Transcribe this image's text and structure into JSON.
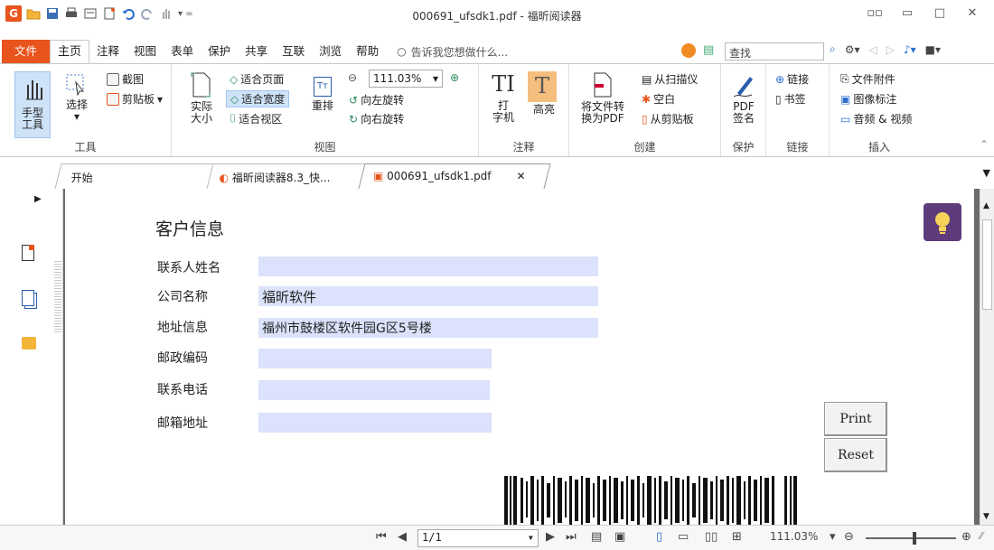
{
  "window": {
    "title": "000691_ufsdk1.pdf - 福昕阅读器"
  },
  "menu": {
    "items": [
      "文件",
      "主页",
      "注释",
      "视图",
      "表单",
      "保护",
      "共享",
      "互联",
      "浏览",
      "帮助"
    ],
    "tell_me": "告诉我您想做什么...",
    "search_placeholder": "查找"
  },
  "ribbon": {
    "tools": {
      "hand": "手型\n工具",
      "select": "选择",
      "screenshot": "截图",
      "clipboard": "剪贴板",
      "label": "工具"
    },
    "view": {
      "actual_size": "实际\n大小",
      "fit_page": "适合页面",
      "fit_width": "适合宽度",
      "fit_view": "适合视区",
      "reflow": "重排",
      "zoom_value": "111.03%",
      "rotate_left": "向左旋转",
      "rotate_right": "向右旋转",
      "label": "视图"
    },
    "comment": {
      "typewriter": "打\n字机",
      "highlight": "高亮",
      "label": "注释"
    },
    "create": {
      "convert": "将文件转\n换为PDF",
      "from_scanner": "从扫描仪",
      "blank": "空白",
      "from_clipboard": "从剪贴板",
      "label": "创建"
    },
    "protect": {
      "pdf_sign": "PDF\n签名",
      "label": "保护"
    },
    "links": {
      "link": "链接",
      "bookmark": "书签",
      "label": "链接"
    },
    "insert": {
      "file_attachment": "文件附件",
      "image_annotation": "图像标注",
      "audio_video": "音频 & 视频",
      "label": "插入"
    }
  },
  "tabs": [
    {
      "label": "开始"
    },
    {
      "label": "福昕阅读器8.3_快..."
    },
    {
      "label": "000691_ufsdk1.pdf"
    }
  ],
  "document": {
    "heading": "客户信息",
    "fields": [
      {
        "label": "联系人姓名",
        "value": ""
      },
      {
        "label": "公司名称",
        "value": "福昕软件"
      },
      {
        "label": "地址信息",
        "value": "福州市鼓楼区软件园G区5号楼"
      },
      {
        "label": "邮政编码",
        "value": ""
      },
      {
        "label": "联系电话",
        "value": ""
      },
      {
        "label": "邮箱地址",
        "value": ""
      }
    ],
    "print_label": "Print",
    "reset_label": "Reset"
  },
  "status": {
    "page": "1/1",
    "zoom": "111.03%"
  },
  "colors": {
    "accent": "#e8541c",
    "field_fill": "#dce2fb",
    "bulb": "#5e3b7a"
  }
}
